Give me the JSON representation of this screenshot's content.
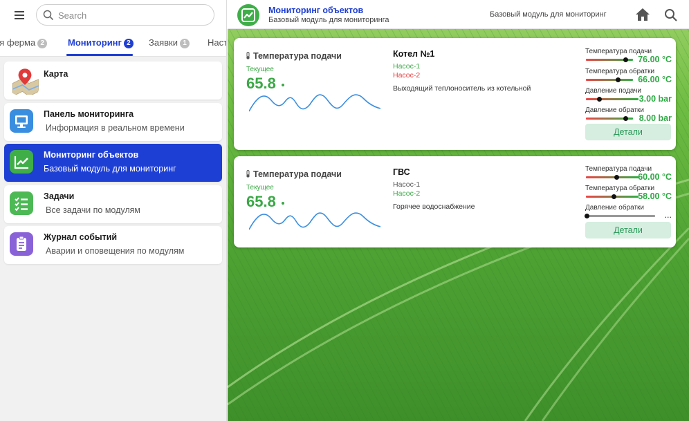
{
  "search": {
    "placeholder": "Search"
  },
  "tabs": [
    {
      "label": "ая ферма",
      "count": "2"
    },
    {
      "label": "Мониторинг",
      "count": "2"
    },
    {
      "label": "Заявки",
      "count": "1"
    },
    {
      "label": "Наст",
      "count": ""
    }
  ],
  "menu": [
    {
      "title": "Карта",
      "subtitle": "",
      "icon": "map-pin-icon"
    },
    {
      "title": "Панель мониторинга",
      "subtitle": "Информация в реальном времени",
      "icon": "monitor-icon"
    },
    {
      "title": "Мониторинг объектов",
      "subtitle": "Базовый модуль для мониторинг",
      "icon": "chart-line-icon"
    },
    {
      "title": "Задачи",
      "subtitle": "Все задачи по модулям",
      "icon": "checklist-icon"
    },
    {
      "title": "Журнал событий",
      "subtitle": "Аварии и оповещения по модулям",
      "icon": "clipboard-icon"
    }
  ],
  "header": {
    "title": "Мониторинг объектов",
    "subtitle": "Базовый модуль для мониторинга",
    "right_text": "Базовый модуль для мониторинг",
    "logo_icon": "chart-line-icon",
    "home_icon": "home-icon",
    "search_icon": "search-icon"
  },
  "colors": {
    "accent": "#1e3fd4",
    "green": "#3aa845",
    "red": "#e23b3b",
    "details_bg": "#d5eedf"
  },
  "cards": [
    {
      "title": "Температура подачи",
      "current_label": "Текущее",
      "current_value": "65.8",
      "object_name": "Котел №1",
      "pump1": "Насос-1",
      "pump1_status": "ok",
      "pump2": "Насос-2",
      "pump2_status": "alarm",
      "description": "Выходящий теплоноситель из котельной",
      "params": [
        {
          "label": "Температура подачи",
          "value": "76.00 °C",
          "fraction": 0.72
        },
        {
          "label": "Температура обратки",
          "value": "66.00 °C",
          "fraction": 0.55
        },
        {
          "label": "Давление подачи",
          "value": "3.00 bar",
          "fraction": 0.25
        },
        {
          "label": "Давление обратки",
          "value": "8.00 bar",
          "fraction": 0.72
        }
      ],
      "details_label": "Детали"
    },
    {
      "title": "Температура подачи",
      "current_label": "Текущее",
      "current_value": "65.8",
      "object_name": "ГВС",
      "pump1": "Насос-1",
      "pump1_status": "neutral",
      "pump2": "Насос-2",
      "pump2_status": "ok",
      "description": "Горячее водоснабжение",
      "params": [
        {
          "label": "Температура подачи",
          "value": "60.00 °C",
          "fraction": 0.55
        },
        {
          "label": "Температура обратки",
          "value": "58.00 °C",
          "fraction": 0.51
        },
        {
          "label": "Давление обратки",
          "value": "...",
          "fraction": 0.0
        }
      ],
      "details_label": "Детали"
    }
  ]
}
